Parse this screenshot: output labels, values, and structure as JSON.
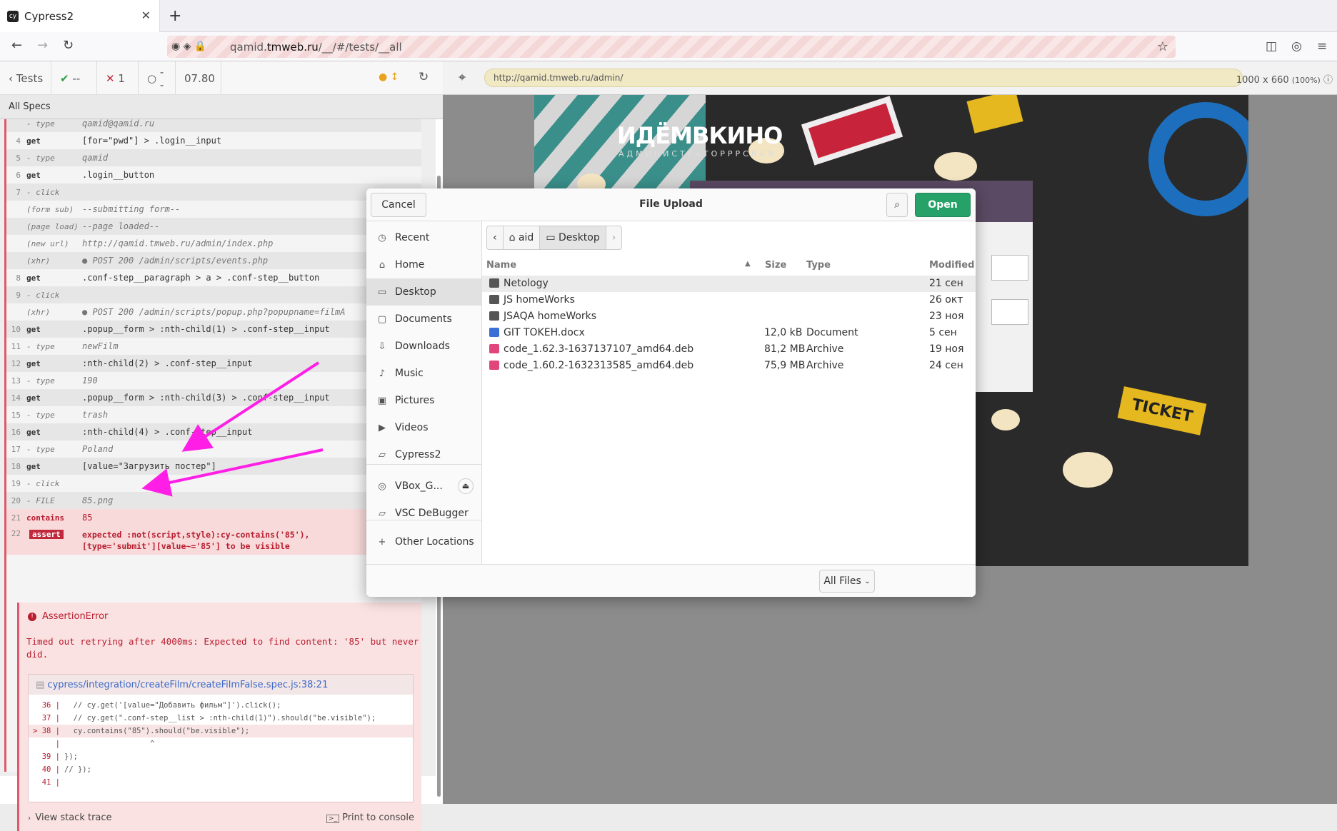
{
  "browser": {
    "tab_title": "Cypress2",
    "tab_favicon": "cy",
    "url_prefix": "qamid.",
    "url_domain": "tmweb.ru",
    "url_path": "/__/#/tests/__all"
  },
  "cypress": {
    "tests_label": "Tests",
    "passed": "--",
    "failed": "1",
    "pending": "--",
    "duration": "07.80",
    "all_specs": "All Specs",
    "commands": [
      {
        "n": "",
        "cmd": "- type",
        "arg": "qamid@qamid.ru",
        "kind": "sub"
      },
      {
        "n": "4",
        "cmd": "get",
        "arg": "[for=\"pwd\"] > .login__input",
        "kind": "cmd"
      },
      {
        "n": "5",
        "cmd": "- type",
        "arg": "qamid",
        "kind": "sub"
      },
      {
        "n": "6",
        "cmd": "get",
        "arg": ".login__button",
        "kind": "cmd"
      },
      {
        "n": "7",
        "cmd": "- click",
        "arg": "",
        "kind": "sub"
      },
      {
        "n": "",
        "cmd": "(form sub)",
        "arg": "--submitting form--",
        "kind": "event"
      },
      {
        "n": "",
        "cmd": "(page load)",
        "arg": "--page loaded--",
        "kind": "event"
      },
      {
        "n": "",
        "cmd": "(new url)",
        "arg": "http://qamid.tmweb.ru/admin/index.php",
        "kind": "event"
      },
      {
        "n": "",
        "cmd": "(xhr)",
        "arg": "● POST 200 /admin/scripts/events.php",
        "kind": "event"
      },
      {
        "n": "8",
        "cmd": "get",
        "arg": ".conf-step__paragraph > a > .conf-step__button",
        "kind": "cmd"
      },
      {
        "n": "9",
        "cmd": "- click",
        "arg": "",
        "kind": "sub"
      },
      {
        "n": "",
        "cmd": "(xhr)",
        "arg": "● POST 200 /admin/scripts/popup.php?popupname=filmA",
        "kind": "event"
      },
      {
        "n": "10",
        "cmd": "get",
        "arg": ".popup__form > :nth-child(1) > .conf-step__input",
        "kind": "cmd"
      },
      {
        "n": "11",
        "cmd": "- type",
        "arg": "newFilm",
        "kind": "sub"
      },
      {
        "n": "12",
        "cmd": "get",
        "arg": ":nth-child(2) > .conf-step__input",
        "kind": "cmd"
      },
      {
        "n": "13",
        "cmd": "- type",
        "arg": "190",
        "kind": "sub"
      },
      {
        "n": "14",
        "cmd": "get",
        "arg": ".popup__form > :nth-child(3) > .conf-step__input",
        "kind": "cmd"
      },
      {
        "n": "15",
        "cmd": "- type",
        "arg": "trash",
        "kind": "sub"
      },
      {
        "n": "16",
        "cmd": "get",
        "arg": ":nth-child(4) > .conf-step__input",
        "kind": "cmd"
      },
      {
        "n": "17",
        "cmd": "- type",
        "arg": "Poland",
        "kind": "sub"
      },
      {
        "n": "18",
        "cmd": "get",
        "arg": "[value=\"Загрузить постер\"]",
        "kind": "cmd"
      },
      {
        "n": "19",
        "cmd": "- click",
        "arg": "",
        "kind": "sub"
      },
      {
        "n": "20",
        "cmd": "- FILE",
        "arg": "85.png",
        "kind": "sub"
      },
      {
        "n": "21",
        "cmd": "contains",
        "arg": "85",
        "kind": "fail"
      }
    ],
    "assert_row": {
      "n": "22",
      "badge": "assert",
      "line1": "expected :not(script,style):cy-contains('85'),",
      "line2": "[type='submit'][value~='85'] to be visible"
    },
    "error": {
      "title": "AssertionError",
      "message": "Timed out retrying after 4000ms: Expected to find content: '85' but never did.",
      "file": "cypress/integration/createFilm/createFilmFalse.spec.js:38:21",
      "code": [
        {
          "ln": "36 |",
          "text": "  // cy.get('[value=\"Добавить фильм\"]').click();",
          "hl": false
        },
        {
          "ln": "37 |",
          "text": "  // cy.get(\".conf-step__list > :nth-child(1)\").should(\"be.visible\");",
          "hl": false
        },
        {
          "ln": "> 38 |",
          "text": "  cy.contains(\"85\").should(\"be.visible\");",
          "hl": true
        },
        {
          "ln": "|",
          "text": "                   ^",
          "hl": false
        },
        {
          "ln": "39 |",
          "text": "});",
          "hl": false
        },
        {
          "ln": "40 |",
          "text": "// });",
          "hl": false
        },
        {
          "ln": "41 |",
          "text": "",
          "hl": false
        }
      ],
      "view_stack": "View stack trace",
      "print": "Print to console"
    }
  },
  "aut": {
    "url": "http://qamid.tmweb.ru/admin/",
    "viewport": "1000 x 660",
    "zoom": "(100%)",
    "logo": "ИДЁМВКИНО",
    "logo_sub": "АДМИНИСТРАТОРРРСКАЯ",
    "ticket_text": "TICKET"
  },
  "dialog": {
    "title": "File Upload",
    "cancel": "Cancel",
    "open": "Open",
    "sidebar": [
      {
        "label": "Recent",
        "icon": "clock-icon"
      },
      {
        "label": "Home",
        "icon": "home-icon"
      },
      {
        "label": "Desktop",
        "icon": "desktop-icon",
        "active": true
      },
      {
        "label": "Documents",
        "icon": "document-icon"
      },
      {
        "label": "Downloads",
        "icon": "download-icon"
      },
      {
        "label": "Music",
        "icon": "music-icon"
      },
      {
        "label": "Pictures",
        "icon": "pictures-icon"
      },
      {
        "label": "Videos",
        "icon": "videos-icon"
      },
      {
        "label": "Cypress2",
        "icon": "folder-icon"
      },
      {
        "label": "VBox_G...",
        "icon": "disc-icon"
      },
      {
        "label": "VSC DeBugger",
        "icon": "folder-icon"
      },
      {
        "label": "Other Locations",
        "icon": "plus-icon"
      }
    ],
    "crumbs": [
      "aid",
      "Desktop"
    ],
    "columns": {
      "name": "Name",
      "size": "Size",
      "type": "Type",
      "modified": "Modified"
    },
    "files": [
      {
        "name": "Netology",
        "size": "",
        "type": "",
        "modified": "21 сен",
        "kind": "folder"
      },
      {
        "name": "JS homeWorks",
        "size": "",
        "type": "",
        "modified": "26 окт",
        "kind": "folder"
      },
      {
        "name": "JSAQA homeWorks",
        "size": "",
        "type": "",
        "modified": "23 ноя",
        "kind": "folder"
      },
      {
        "name": "GIT TOKEH.docx",
        "size": "12,0 kB",
        "type": "Document",
        "modified": "5 сен",
        "kind": "doc"
      },
      {
        "name": "code_1.62.3-1637137107_amd64.deb",
        "size": "81,2 MB",
        "type": "Archive",
        "modified": "19 ноя",
        "kind": "deb"
      },
      {
        "name": "code_1.60.2-1632313585_amd64.deb",
        "size": "75,9 MB",
        "type": "Archive",
        "modified": "24 сен",
        "kind": "deb"
      }
    ],
    "filter": "All Files"
  }
}
